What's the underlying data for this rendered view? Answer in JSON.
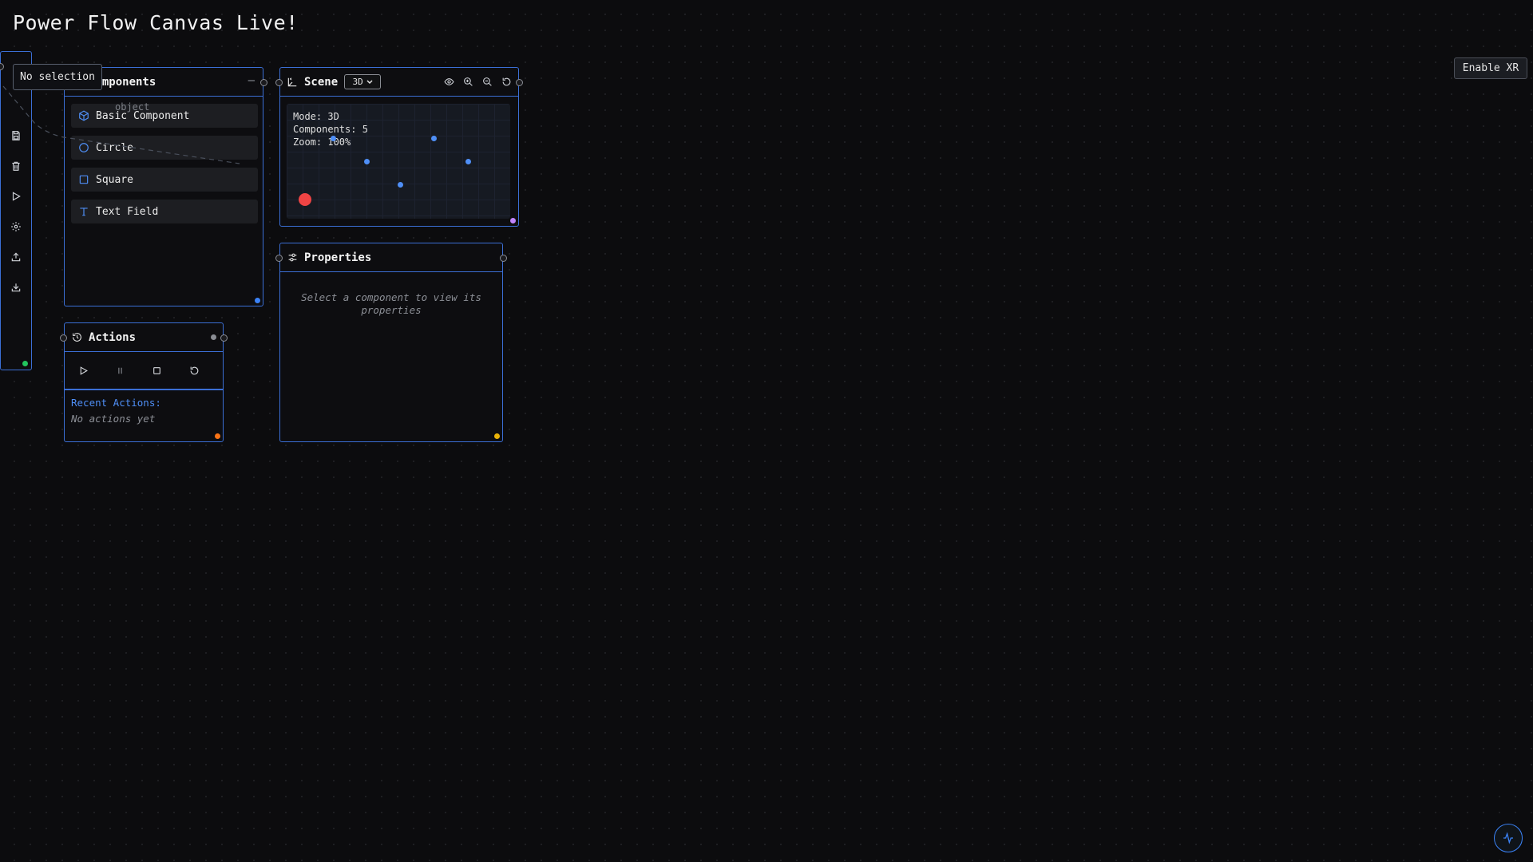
{
  "app": {
    "title": "Power Flow Canvas Live!",
    "xr_button": "Enable XR"
  },
  "toolbar": {
    "tooltip": "No selection",
    "connector_label": "object",
    "tools": [
      {
        "name": "save-icon"
      },
      {
        "name": "trash-icon"
      },
      {
        "name": "play-icon"
      },
      {
        "name": "gear-icon"
      },
      {
        "name": "upload-icon"
      },
      {
        "name": "download-icon"
      }
    ]
  },
  "components_panel": {
    "title": "Components",
    "items": [
      {
        "label": "Basic Component",
        "icon": "cube-icon"
      },
      {
        "label": "Circle",
        "icon": "circle-icon"
      },
      {
        "label": "Square",
        "icon": "square-icon"
      },
      {
        "label": "Text Field",
        "icon": "text-icon"
      }
    ]
  },
  "scene_panel": {
    "title": "Scene",
    "mode_select": "3D",
    "info": {
      "mode": "Mode: 3D",
      "components": "Components: 5",
      "zoom": "Zoom: 100%"
    }
  },
  "properties_panel": {
    "title": "Properties",
    "empty_text": "Select a component to view its properties"
  },
  "actions_panel": {
    "title": "Actions",
    "recent_label": "Recent Actions:",
    "empty_text": "No actions yet"
  },
  "colors": {
    "accent": "#3b82f6",
    "panel_border": "#3b6fd6",
    "scene_dot": "#4f8ff7",
    "red_marker": "#ef4444",
    "green_dot": "#22c55e",
    "orange_dot": "#f97316",
    "yellow_dot": "#eab308",
    "purple_dot": "#c084fc"
  }
}
